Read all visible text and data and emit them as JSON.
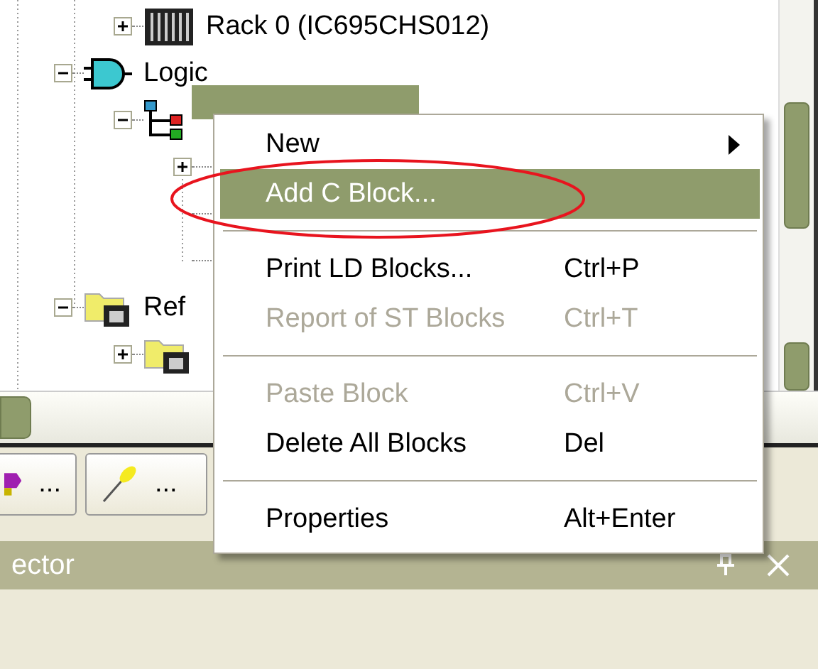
{
  "tree": {
    "items": [
      {
        "children": [
          {
            "label": "Rack 0 (IC695CHS012)",
            "kind": "rack",
            "expanded": false,
            "selected": false
          }
        ]
      },
      {
        "label": "Logic",
        "kind": "gate",
        "expanded": true,
        "selected": false,
        "children": [
          {
            "kind": "blocks",
            "expanded": true,
            "selected": true,
            "children": [
              {
                "expanded": false
              }
            ]
          }
        ]
      },
      {
        "label": "Ref",
        "kind": "folder",
        "expanded": true,
        "selected": false,
        "children": [
          {
            "kind": "folder",
            "expanded": false,
            "selected": false
          }
        ]
      }
    ]
  },
  "context_menu": {
    "items": [
      {
        "kind": "item",
        "label": "New",
        "submenu": true,
        "disabled": false,
        "selected": false
      },
      {
        "kind": "item",
        "label": "Add C Block...",
        "disabled": false,
        "selected": true
      },
      {
        "kind": "separator"
      },
      {
        "kind": "item",
        "label": "Print LD Blocks...",
        "shortcut": "Ctrl+P",
        "disabled": false,
        "selected": false
      },
      {
        "kind": "item",
        "label": "Report of ST Blocks",
        "shortcut": "Ctrl+T",
        "disabled": true,
        "selected": false
      },
      {
        "kind": "separator"
      },
      {
        "kind": "item",
        "label": "Paste Block",
        "shortcut": "Ctrl+V",
        "disabled": true,
        "selected": false
      },
      {
        "kind": "item",
        "label": "Delete All Blocks",
        "shortcut": "Del",
        "disabled": false,
        "selected": false
      },
      {
        "kind": "separator"
      },
      {
        "kind": "item",
        "label": "Properties",
        "shortcut": "Alt+Enter",
        "disabled": false,
        "selected": false
      }
    ]
  },
  "tool_tabs": [
    {
      "label": "..."
    },
    {
      "label": "..."
    }
  ],
  "panel": {
    "title": "ector"
  }
}
